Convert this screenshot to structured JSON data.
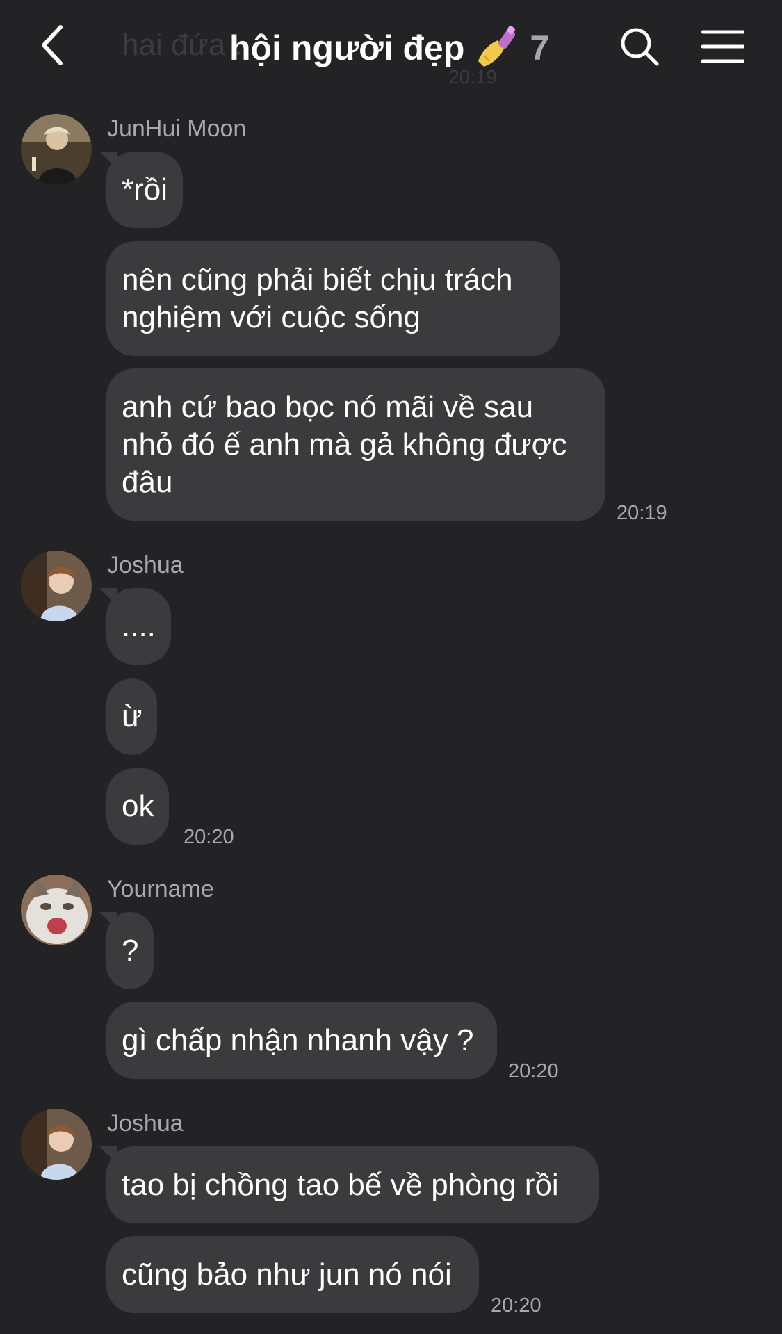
{
  "header": {
    "ghost_text": "hai đứa ... ",
    "ghost_time": "20:19",
    "title": "hội người đẹp",
    "title_emoji": "nail-polish-emoji",
    "member_count": "7",
    "back_icon": "chevron-left-icon",
    "search_icon": "search-icon",
    "menu_icon": "hamburger-menu-icon"
  },
  "colors": {
    "background": "#232325",
    "bubble": "#3b3b3e",
    "text": "#ffffff",
    "muted": "#a9a9ad"
  },
  "groups": [
    {
      "sender": "JunHui Moon",
      "avatar": "junhui-avatar",
      "messages": [
        "*rồi",
        "nên cũng phải biết chịu trách\nnghiệm với cuộc sống",
        "anh cứ bao bọc nó mãi về sau\nnhỏ đó ế anh mà gả không được\nđâu"
      ],
      "time": "20:19"
    },
    {
      "sender": "Joshua",
      "avatar": "joshua-avatar",
      "messages": [
        "....",
        "ừ",
        "ok"
      ],
      "time": "20:20"
    },
    {
      "sender": "Yourname",
      "avatar": "cat-avatar",
      "messages": [
        "?",
        "gì chấp nhận nhanh vậy ?"
      ],
      "time": "20:20"
    },
    {
      "sender": "Joshua",
      "avatar": "joshua-avatar",
      "messages": [
        "tao bị chồng tao bế về phòng rồi",
        "cũng bảo như jun nó nói"
      ],
      "time": "20:20"
    }
  ]
}
